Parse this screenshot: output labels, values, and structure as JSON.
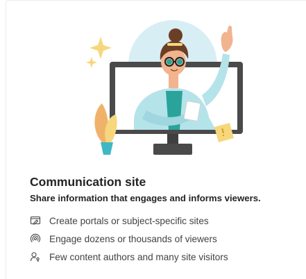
{
  "card": {
    "title": "Communication site",
    "subtitle": "Share information that engages and informs viewers.",
    "features": [
      {
        "icon": "page-edit-icon",
        "label": "Create portals or subject-specific sites"
      },
      {
        "icon": "broadcast-icon",
        "label": "Engage dozens or thousands of viewers"
      },
      {
        "icon": "people-key-icon",
        "label": "Few content authors and many site visitors"
      }
    ]
  },
  "colors": {
    "text_primary": "#242424",
    "text_secondary": "#424242",
    "monitor": "#4a4a4a",
    "circle_bg": "#d7eef5",
    "shirt": "#b5e3ea",
    "accent_yellow": "#f6d77c"
  }
}
